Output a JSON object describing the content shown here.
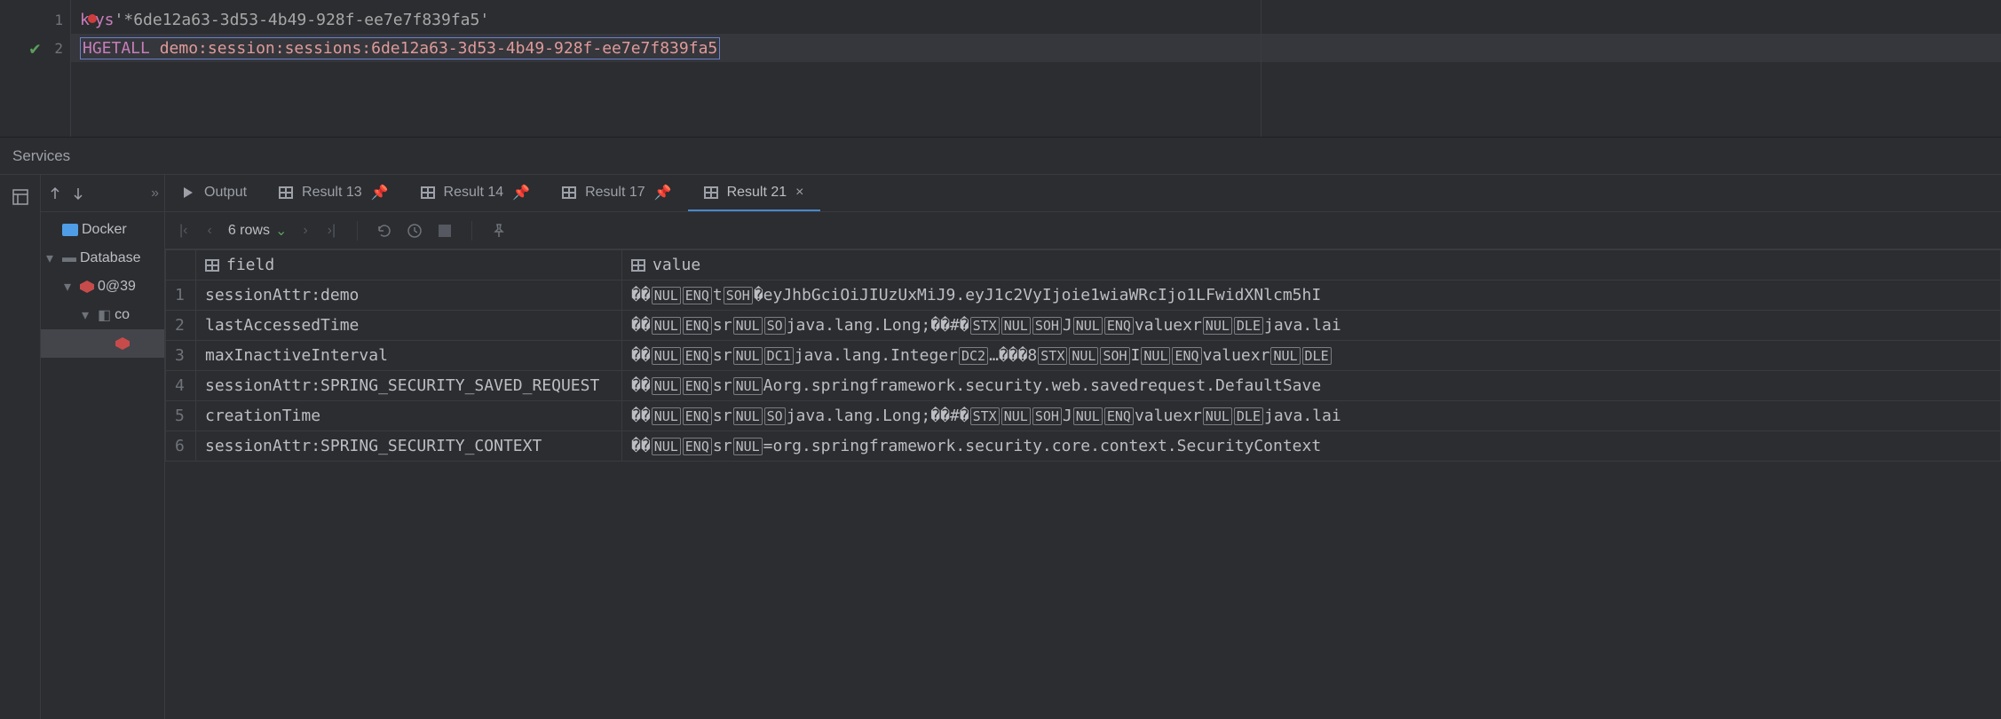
{
  "editor": {
    "lines": [
      {
        "num": "1",
        "check": false,
        "kw_pre": "k",
        "kw_post": "ys",
        "str": " '*6de12a63-3d53-4b49-928f-ee7e7f839fa5'"
      },
      {
        "num": "2",
        "check": true,
        "cmd": "HGETALL",
        "arg": "demo:session:sessions:6de12a63-3d53-4b49-928f-ee7e7f839fa5"
      }
    ]
  },
  "panel_title": "Services",
  "tree": {
    "head_icons_label": "",
    "items": [
      {
        "label": "Docker",
        "indent": 0,
        "icon": "docker",
        "arrow": ""
      },
      {
        "label": "Database",
        "indent": 0,
        "icon": "folder",
        "arrow": "▾"
      },
      {
        "label": "0@39",
        "indent": 1,
        "icon": "redis",
        "arrow": "▾"
      },
      {
        "label": "co",
        "indent": 2,
        "icon": "db",
        "arrow": "▾"
      },
      {
        "label": "",
        "indent": 3,
        "icon": "redis",
        "arrow": "",
        "selected": true
      }
    ]
  },
  "tabs": [
    {
      "icon": "play",
      "label": "Output",
      "badge": "",
      "close": ""
    },
    {
      "icon": "grid",
      "label": "Result 13",
      "badge": "pin",
      "close": ""
    },
    {
      "icon": "grid",
      "label": "Result 14",
      "badge": "pin",
      "close": ""
    },
    {
      "icon": "grid",
      "label": "Result 17",
      "badge": "pin",
      "close": ""
    },
    {
      "icon": "grid",
      "label": "Result 21",
      "badge": "",
      "close": "×",
      "active": true
    }
  ],
  "res_toolbar": {
    "rows_label": "6 rows"
  },
  "columns": {
    "c1": "field",
    "c2": "value"
  },
  "rows": [
    {
      "n": "1",
      "field": "sessionAttr:demo",
      "value_parts": [
        "��",
        {
          "c": "NUL"
        },
        {
          "c": "ENQ"
        },
        "t",
        {
          "c": "SOH"
        },
        "�eyJhbGciOiJIUzUxMiJ9.eyJ1c2VyIjoie1wiaWRcIjo1LFwidXNlcm5hI"
      ]
    },
    {
      "n": "2",
      "field": "lastAccessedTime",
      "value_parts": [
        "��",
        {
          "c": "NUL"
        },
        {
          "c": "ENQ"
        },
        "sr",
        {
          "c": "NUL"
        },
        {
          "c": "SO"
        },
        "java.lang.Long;��#�",
        {
          "c": "STX"
        },
        {
          "c": "NUL"
        },
        {
          "c": "SOH"
        },
        "J",
        {
          "c": "NUL"
        },
        {
          "c": "ENQ"
        },
        "valuexr",
        {
          "c": "NUL"
        },
        {
          "c": "DLE"
        },
        "java.lai"
      ]
    },
    {
      "n": "3",
      "field": "maxInactiveInterval",
      "value_parts": [
        "��",
        {
          "c": "NUL"
        },
        {
          "c": "ENQ"
        },
        "sr",
        {
          "c": "NUL"
        },
        {
          "c": "DC1"
        },
        "java.lang.Integer",
        {
          "c": "DC2"
        },
        "…���8",
        {
          "c": "STX"
        },
        {
          "c": "NUL"
        },
        {
          "c": "SOH"
        },
        "I",
        {
          "c": "NUL"
        },
        {
          "c": "ENQ"
        },
        "valuexr",
        {
          "c": "NUL"
        },
        {
          "c": "DLE"
        }
      ]
    },
    {
      "n": "4",
      "field": "sessionAttr:SPRING_SECURITY_SAVED_REQUEST",
      "value_parts": [
        "��",
        {
          "c": "NUL"
        },
        {
          "c": "ENQ"
        },
        "sr",
        {
          "c": "NUL"
        },
        "Aorg.springframework.security.web.savedrequest.DefaultSave"
      ]
    },
    {
      "n": "5",
      "field": "creationTime",
      "value_parts": [
        "��",
        {
          "c": "NUL"
        },
        {
          "c": "ENQ"
        },
        "sr",
        {
          "c": "NUL"
        },
        {
          "c": "SO"
        },
        "java.lang.Long;��#�",
        {
          "c": "STX"
        },
        {
          "c": "NUL"
        },
        {
          "c": "SOH"
        },
        "J",
        {
          "c": "NUL"
        },
        {
          "c": "ENQ"
        },
        "valuexr",
        {
          "c": "NUL"
        },
        {
          "c": "DLE"
        },
        "java.lai"
      ]
    },
    {
      "n": "6",
      "field": "sessionAttr:SPRING_SECURITY_CONTEXT",
      "value_parts": [
        "��",
        {
          "c": "NUL"
        },
        {
          "c": "ENQ"
        },
        "sr",
        {
          "c": "NUL"
        },
        "=org.springframework.security.core.context.SecurityContext"
      ]
    }
  ]
}
